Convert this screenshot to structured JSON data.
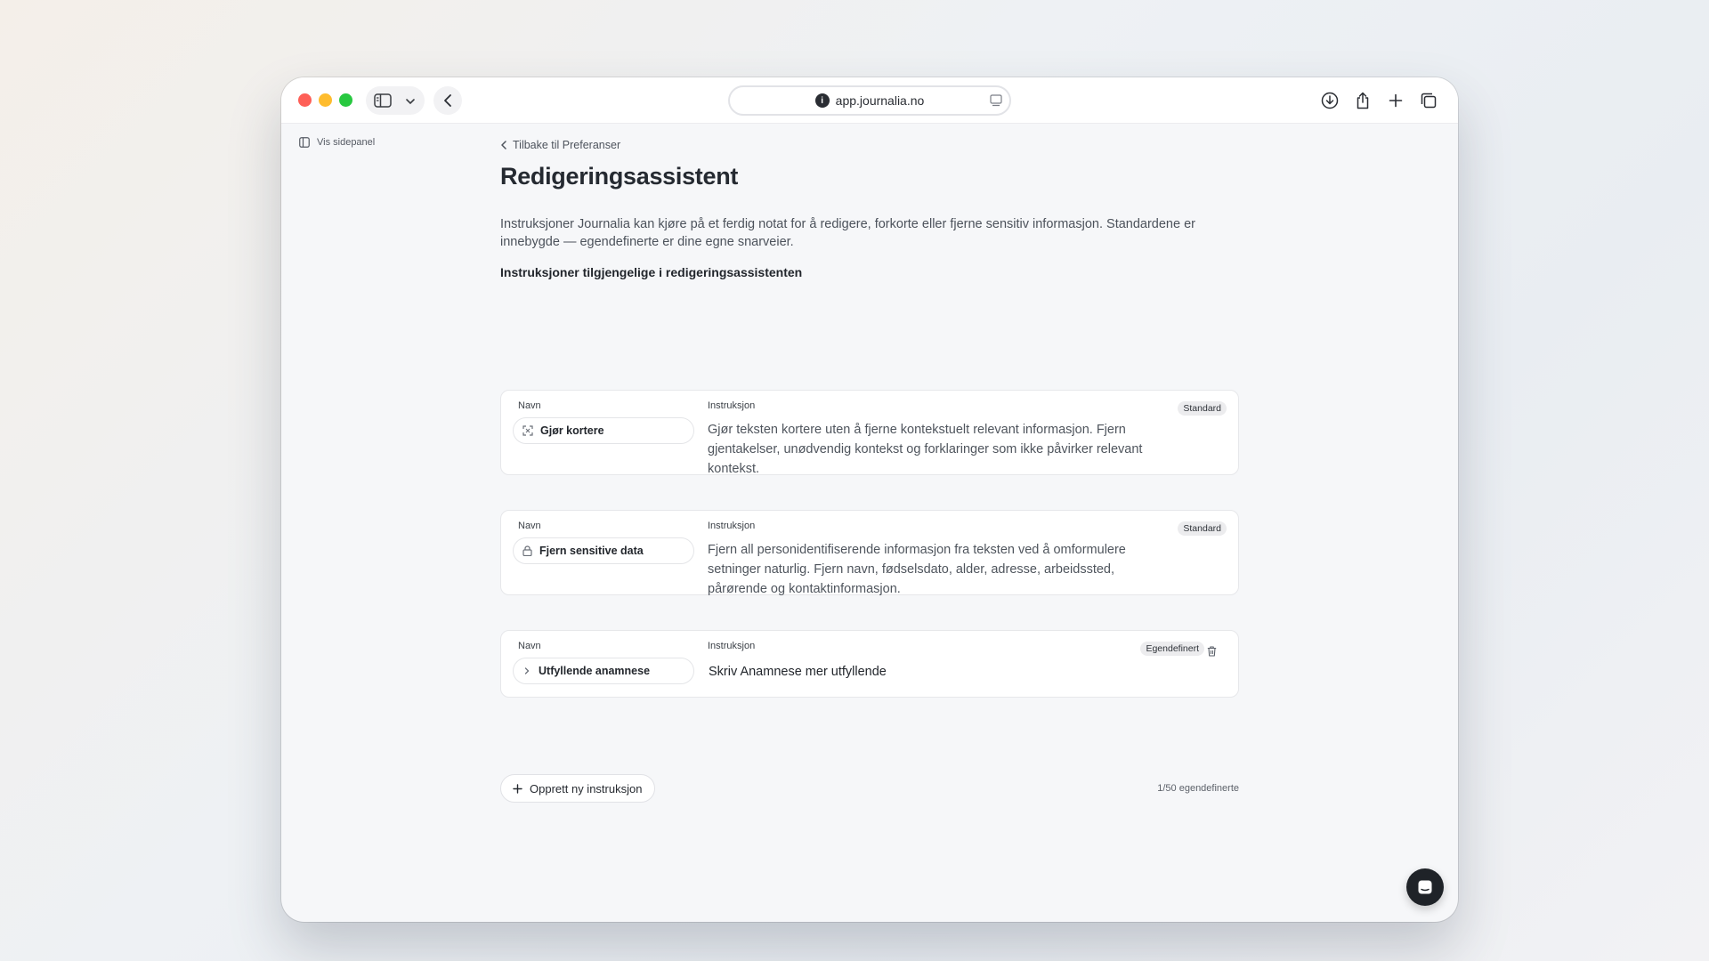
{
  "browser": {
    "url": "app.journalia.no",
    "icons": [
      "sidebar-icon",
      "chevron-down-icon",
      "back-icon",
      "reader-icon",
      "download-icon",
      "share-icon",
      "plus-icon",
      "tabs-icon"
    ]
  },
  "sidebar": {
    "toggle_label": "Vis sidepanel"
  },
  "page": {
    "back_label": "Tilbake til Preferanser",
    "title": "Redigeringsassistent",
    "intro": "Instruksjoner Journalia kan kjøre på et ferdig notat for å redigere, forkorte eller fjerne sensitiv informasjon. Standardene er innebygde — egendefinerte er dine egne snarveier.",
    "section_title": "Instruksjoner tilgjengelige i redigeringsassistenten"
  },
  "labels": {
    "name": "Navn",
    "instruction": "Instruksjon"
  },
  "instructions": [
    {
      "name": "Gjør kortere",
      "icon": "shrink-icon",
      "text": "Gjør teksten kortere uten å fjerne kontekstuelt relevant informasjon. Fjern gjentakelser, unødvendig kontekst og forklaringer som ikke påvirker relevant kontekst.",
      "badge": "Standard"
    },
    {
      "name": "Fjern sensitive data",
      "icon": "lock-icon",
      "text": "Fjern all personidentifiserende informasjon fra teksten ved å omformulere setninger naturlig. Fjern navn, fødselsdato, alder, adresse, arbeidssted, pårørende og kontaktinformasjon.",
      "badge": "Standard"
    },
    {
      "name": "Utfyllende anamnese",
      "icon": "chevron-right-icon",
      "text": "Skriv Anamnese mer utfyllende",
      "badge": "Egendefinert"
    }
  ],
  "footer": {
    "create_label": "Opprett ny instruksjon",
    "counter": "1/50 egendefinerte"
  },
  "colors": {
    "accent_dark": "#1f2328",
    "badge_bg": "#ececee"
  }
}
